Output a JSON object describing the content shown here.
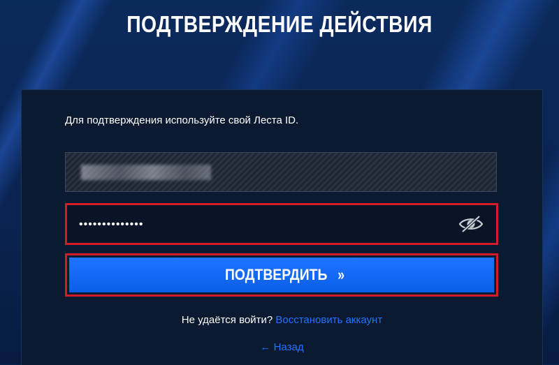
{
  "page": {
    "title": "ПОДТВЕРЖДЕНИЕ ДЕЙСТВИЯ"
  },
  "form": {
    "intro_text": "Для подтверждения используйте свой Леста ID.",
    "password_value": "••••••••••••••",
    "submit_label": "ПОДТВЕРДИТЬ",
    "submit_chevron": "»"
  },
  "help": {
    "question": "Не удаётся войти?",
    "recover_link": "Восстановить аккаунт"
  },
  "back": {
    "arrow": "←",
    "label": "Назад"
  },
  "colors": {
    "accent": "#1f74ff",
    "highlight_border": "#d21c2a",
    "card_bg": "#0b1a30"
  },
  "icons": {
    "password_toggle": "eye-slash-icon"
  }
}
